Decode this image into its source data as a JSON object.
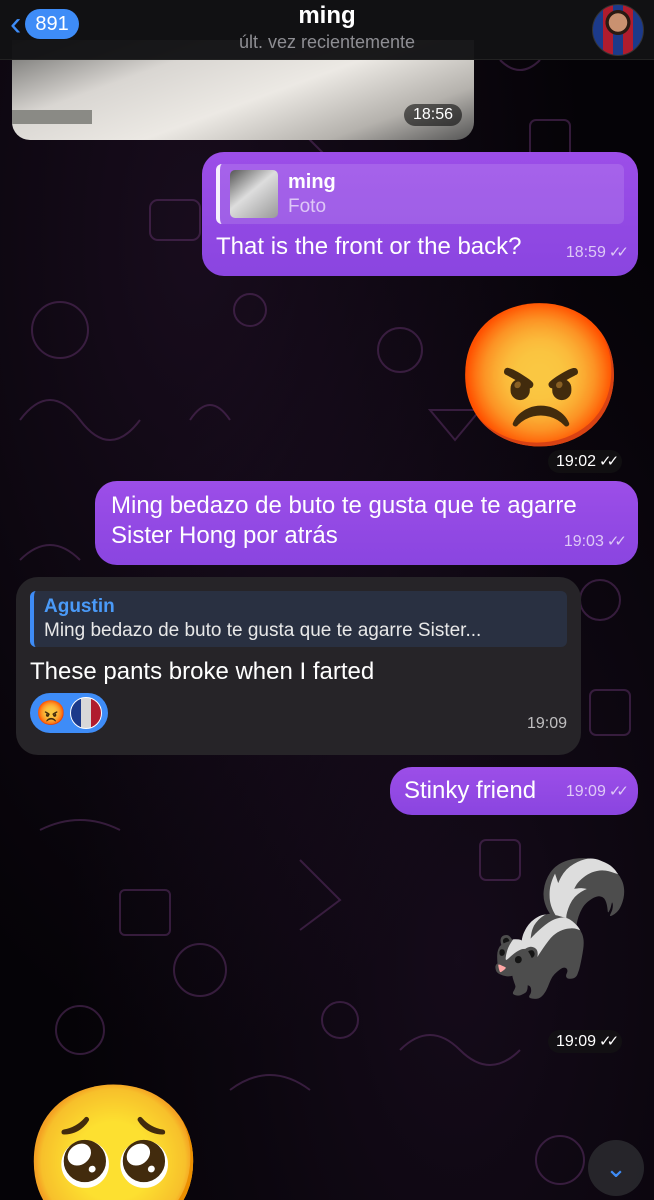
{
  "header": {
    "back_count": "891",
    "title": "ming",
    "status": "últ. vez recientemente"
  },
  "messages": {
    "photo": {
      "time": "18:56"
    },
    "reply1": {
      "quote_name": "ming",
      "quote_text": "Foto",
      "text": "That is the front or the back?",
      "time": "18:59"
    },
    "angry": {
      "emoji": "😡",
      "time": "19:02"
    },
    "ming_msg": {
      "line1": "Ming bedazo de buto te gusta que te agarre",
      "line2": "Sister Hong por atrás",
      "time": "19:03"
    },
    "incoming": {
      "quote_name": "Agustin",
      "quote_text": "Ming bedazo de buto te gusta que te agarre Sister...",
      "text": "These pants broke when I farted",
      "reaction_emoji": "😡",
      "time": "19:09"
    },
    "stinky": {
      "text": "Stinky friend",
      "time": "19:09"
    },
    "skunk": {
      "emoji": "🦨",
      "time": "19:09"
    },
    "pleading": {
      "emoji": "🥺"
    }
  },
  "colors": {
    "accent": "#3e8cf7",
    "outgoing_bubble": "#8a45e0",
    "incoming_bubble": "#262428"
  }
}
